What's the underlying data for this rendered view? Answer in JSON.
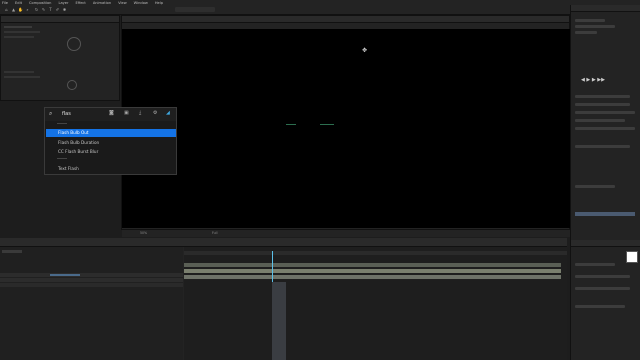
{
  "menu": [
    "File",
    "Edit",
    "Composition",
    "Layer",
    "Effect",
    "Animation",
    "View",
    "Window",
    "Help"
  ],
  "toolbar_icons": [
    "home-icon",
    "selection-icon",
    "hand-icon",
    "zoom-icon",
    "orbit-icon",
    "pen-icon",
    "text-icon",
    "brush-icon",
    "puppet-icon"
  ],
  "search": {
    "query": "flas",
    "results": [
      {
        "label": "Flash Bulb Out",
        "selected": true
      },
      {
        "label": "Flash Bulb Duration",
        "selected": false
      },
      {
        "label": "CC Flash Burst Blur",
        "selected": false
      },
      {
        "label": "Text Flash",
        "selected": false
      }
    ]
  },
  "viewer": {
    "zoom": "50%",
    "quality": "Full"
  },
  "colors": {
    "accent": "#1473e6",
    "playhead": "#5bc0e8",
    "work_area": "#4a4a4a"
  }
}
